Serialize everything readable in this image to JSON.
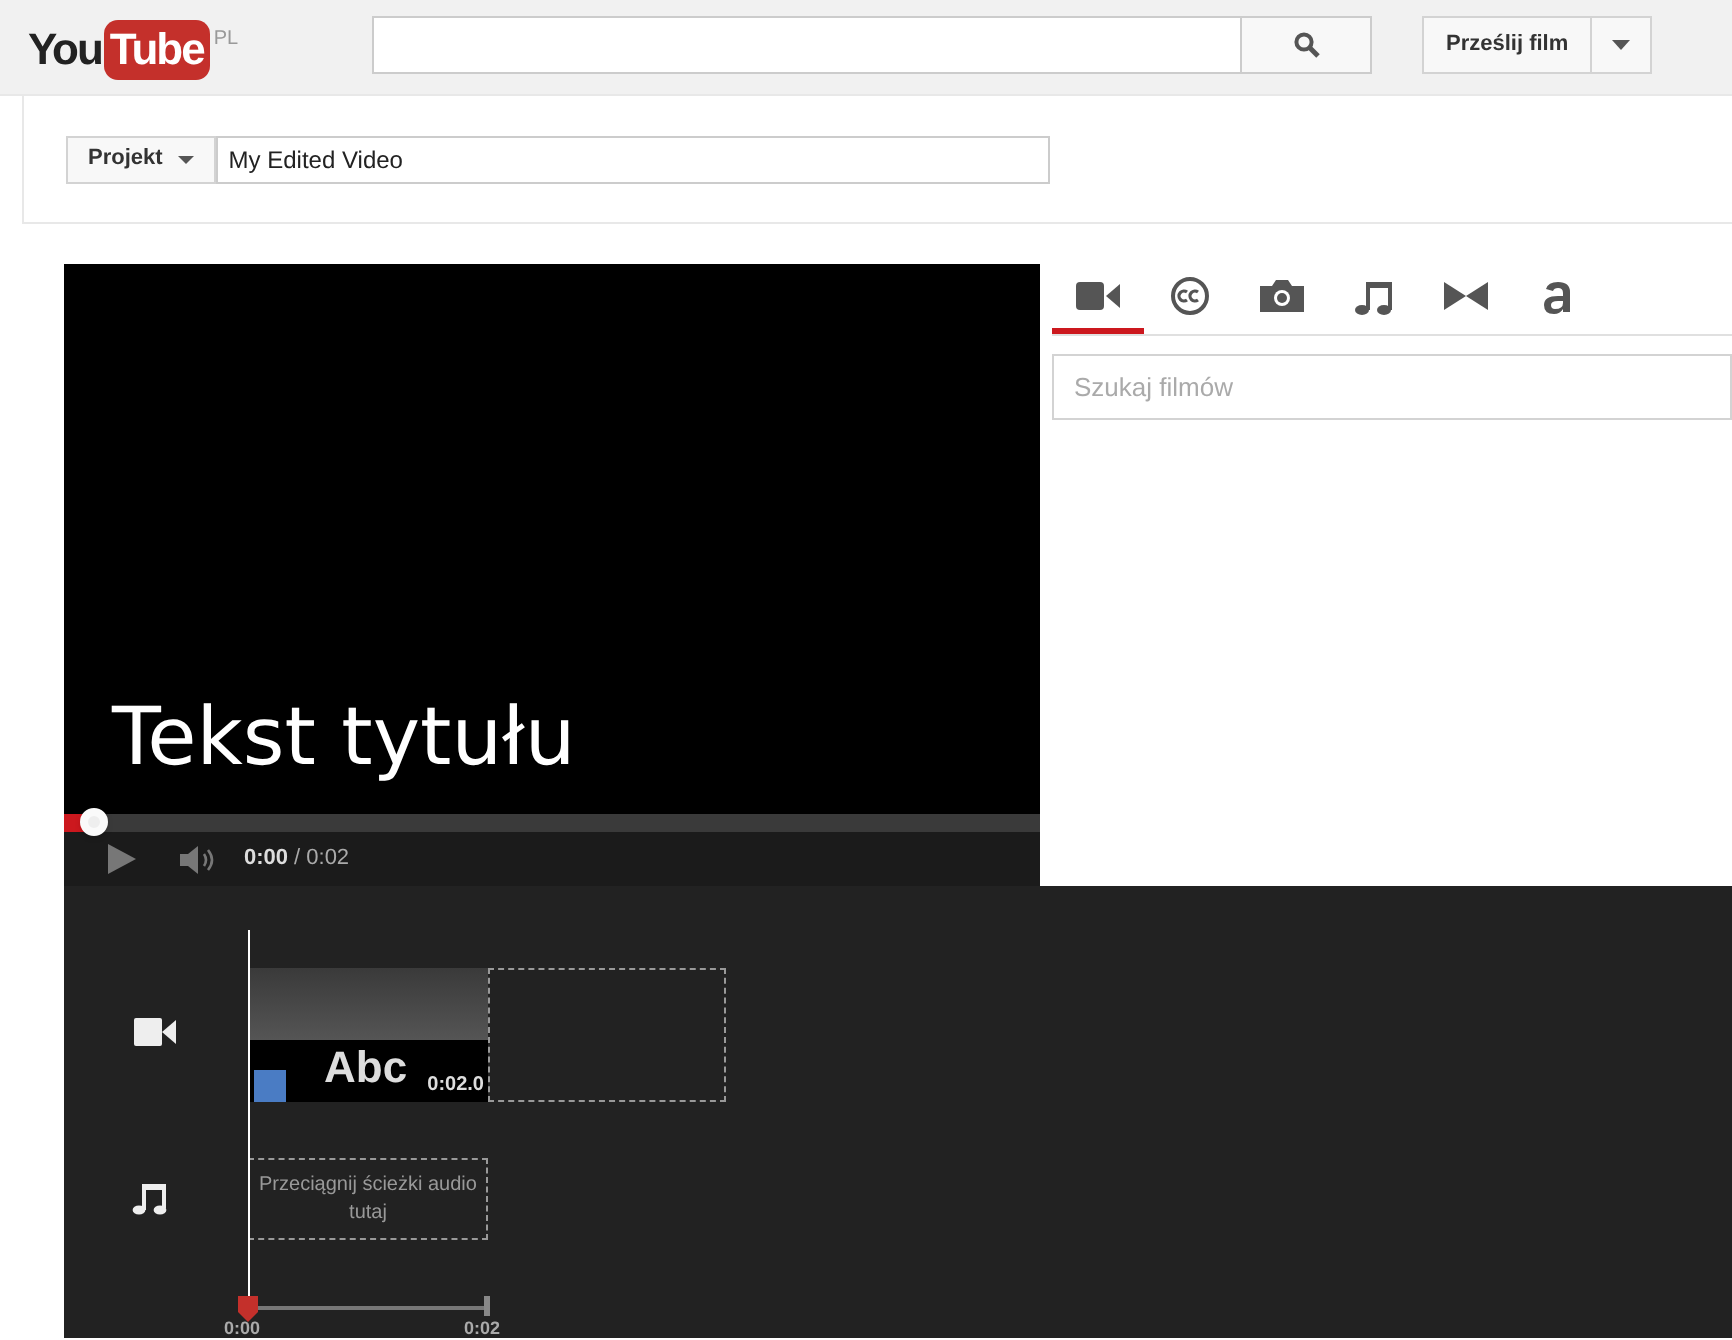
{
  "header": {
    "logo": {
      "you": "You",
      "tube": "Tube",
      "region": "PL"
    },
    "upload_button": "Prześlij film"
  },
  "project": {
    "menu": "Projekt",
    "title_value": "My Edited Video"
  },
  "player": {
    "overlay_text": "Tekst tytułu",
    "progress": {
      "level": 0.02
    },
    "current_time": "0:00",
    "total_time": "/ 0:02"
  },
  "panel": {
    "tabs": [
      {
        "kind": "video",
        "selected": true
      },
      {
        "kind": "captions",
        "selected": false
      },
      {
        "kind": "photo",
        "selected": false
      },
      {
        "kind": "music",
        "selected": false
      },
      {
        "kind": "transition",
        "selected": false
      },
      {
        "kind": "text",
        "selected": false
      }
    ],
    "search": {
      "placeholder": "Szukaj filmów"
    }
  },
  "timeline": {
    "clip": {
      "title": "Abc",
      "duration": "0:02.0"
    },
    "audio_drop_hint": "Przeciągnij ścieżki audio tutaj",
    "ruler": [
      "0:00",
      "0:02"
    ]
  }
}
